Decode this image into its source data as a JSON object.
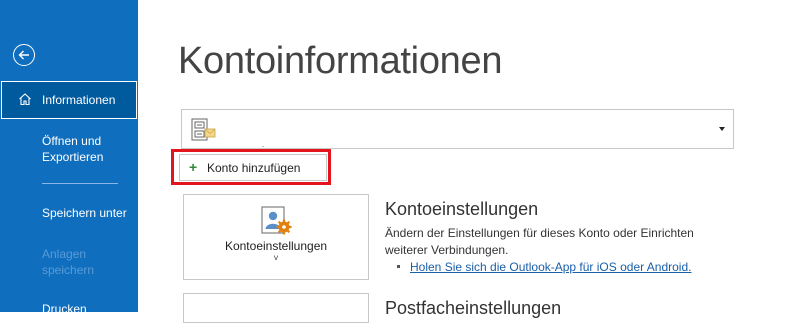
{
  "sidebar": {
    "items": [
      {
        "label": "Informationen"
      },
      {
        "label": "Öffnen und Exportieren"
      },
      {
        "label": "Speichern unter"
      },
      {
        "label": "Anlagen speichern"
      },
      {
        "label": "Drucken"
      }
    ]
  },
  "main": {
    "title": "Kontoinformationen",
    "add_account_label": "Konto hinzufügen",
    "account_settings": {
      "tile_label": "Kontoeinstellungen",
      "tile_chevron": "˅",
      "title": "Kontoeinstellungen",
      "description": "Ändern der Einstellungen für dieses Konto oder Einrichten weiterer Verbindungen.",
      "link": "Holen Sie sich die Outlook-App für iOS oder Android."
    },
    "mailbox_settings": {
      "title": "Postfacheinstellungen"
    }
  },
  "colors": {
    "sidebar_bg": "#106ebe",
    "highlight_border": "#e3141e",
    "link": "#1a5fa8"
  }
}
